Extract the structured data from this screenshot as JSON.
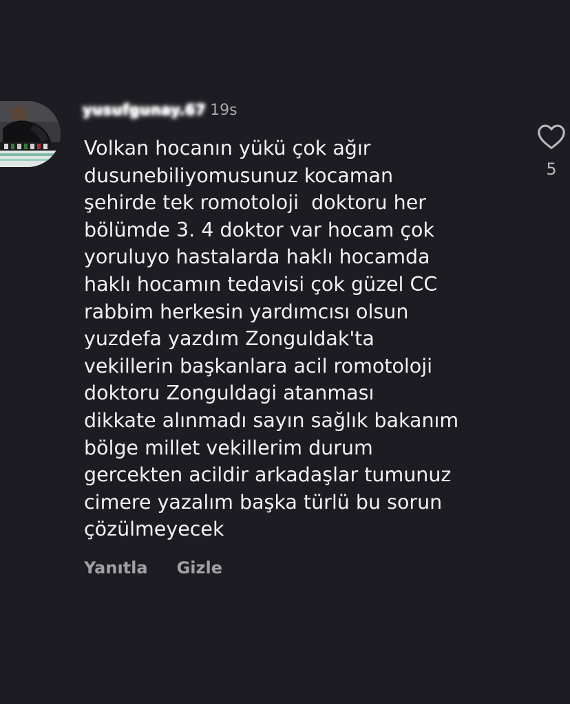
{
  "comment": {
    "username": "yusufgunay.67",
    "time": "19s",
    "text": "Volkan hocanın yükü çok ağır\ndusunebiliyomusunuz kocaman\nşehirde tek romotoloji  doktoru her\nbölümde 3. 4 doktor var hocam çok\nyoruluyo hastalarda haklı hocamda\nhaklı hocamın tedavisi çok güzel CC\nrabbim herkesin yardımcısı olsun\nyuzdefa yazdım Zonguldak'ta\nvekillerin başkanlara acil romotoloji\ndoktoru Zonguldagi atanması\ndikkate alınmadı sayın sağlık bakanım\nbölge millet vekillerim durum\ngercekten acildir arkadaşlar tumunuz\ncimere yazalım başka türlü bu sorun\nçözülmeyecek",
    "like_count": "5",
    "actions": {
      "reply_label": "Yanıtla",
      "hide_label": "Gizle"
    }
  },
  "icons": {
    "like": "heart-outline-icon",
    "avatar": "user-avatar"
  },
  "colors": {
    "background": "#1c1c22",
    "text": "#f2f2f2",
    "secondary_text": "#a1a1a6"
  }
}
